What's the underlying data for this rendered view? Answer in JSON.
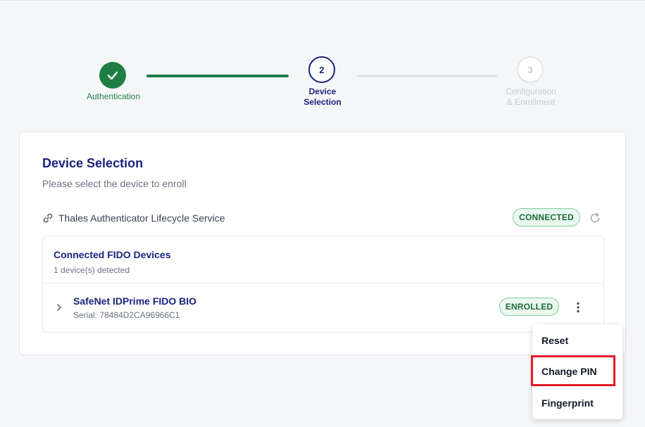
{
  "stepper": {
    "steps": [
      {
        "label_line1": "Authentication",
        "label_line2": "",
        "state": "done"
      },
      {
        "number": "2",
        "label_line1": "Device",
        "label_line2": "Selection",
        "state": "active"
      },
      {
        "number": "3",
        "label_line1": "Configuration",
        "label_line2": "& Enrollment",
        "state": "upcoming"
      }
    ]
  },
  "card": {
    "title": "Device Selection",
    "subtitle": "Please select the device to enroll",
    "service": {
      "name": "Thales Authenticator Lifecycle Service",
      "status": "CONNECTED"
    },
    "devices": {
      "title": "Connected FIDO Devices",
      "count_text": "1 device(s) detected",
      "items": [
        {
          "name": "SafeNet IDPrime FIDO BIO",
          "serial": "Serial: 78484D2CA96966C1",
          "status": "ENROLLED"
        }
      ]
    }
  },
  "menu": {
    "items": [
      "Reset",
      "Change PIN",
      "Fingerprint"
    ]
  },
  "colors": {
    "primary": "#1a237e",
    "success": "#1e7e45",
    "highlight": "#e11d2a"
  },
  "icons": [
    "check-icon",
    "link-icon",
    "refresh-icon",
    "chevron-right-icon",
    "kebab-menu-icon"
  ]
}
